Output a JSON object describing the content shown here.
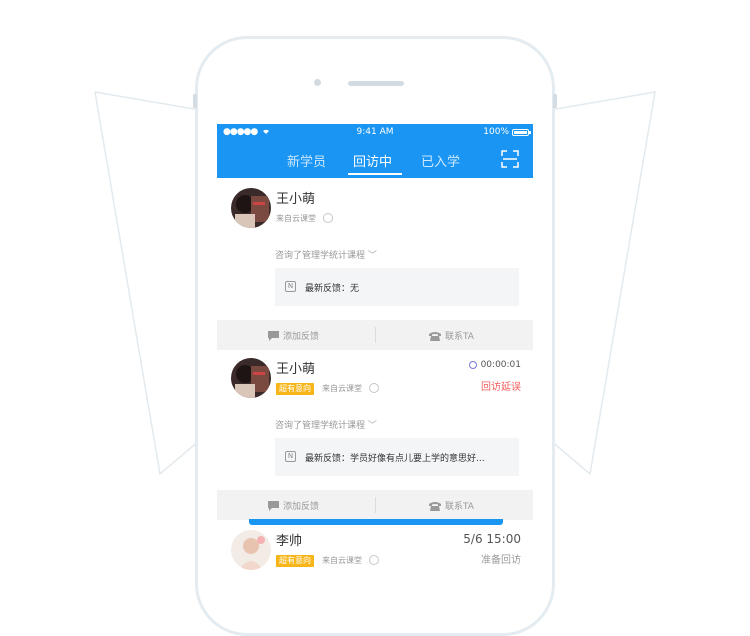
{
  "status_bar": {
    "signal": "●●●●●",
    "time": "9:41 AM",
    "battery": "100%"
  },
  "tabs": [
    {
      "label": "新学员"
    },
    {
      "label": "回访中"
    },
    {
      "label": "已入学"
    }
  ],
  "cards": [
    {
      "name": "王小萌",
      "tag": "",
      "source": "来自云课堂",
      "consult": "咨询了管理学统计课程",
      "feedback": "最新反馈：无",
      "actions": {
        "add": "添加反馈",
        "contact": "联系TA"
      }
    },
    {
      "name": "王小萌",
      "tag": "超有意向",
      "source": "来自云课堂",
      "timer": "00:00:01",
      "status": "回访延误",
      "consult": "咨询了管理学统计课程",
      "feedback": "最新反馈：学员好像有点儿要上学的意思好...",
      "actions": {
        "add": "添加反馈",
        "contact": "联系TA"
      }
    },
    {
      "name": "李帅",
      "tag": "超有意向",
      "source": "来自云课堂",
      "date": "5/6 15:00",
      "status": "准备回访"
    }
  ],
  "colors": {
    "primary": "#1a95f4",
    "tag": "#f7b518",
    "alert": "#f55c5c"
  }
}
